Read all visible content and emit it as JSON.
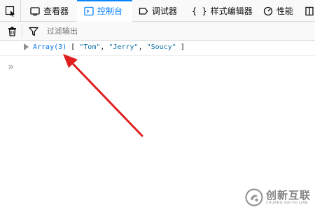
{
  "tabs": [
    {
      "label": "查看器",
      "icon": "inspector-icon"
    },
    {
      "label": "控制台",
      "icon": "console-icon",
      "selected": true
    },
    {
      "label": "调试器",
      "icon": "debugger-icon"
    },
    {
      "label": "样式编辑器",
      "icon": "style-editor-icon"
    },
    {
      "label": "性能",
      "icon": "performance-icon"
    },
    {
      "label": "",
      "icon": "more-tools-icon"
    }
  ],
  "toolbar": {
    "clear_icon": "trash-icon",
    "filter_icon": "filter-icon",
    "filter_placeholder": "过滤输出"
  },
  "console": {
    "message": {
      "array_name": "Array(3)",
      "open_bracket": "[",
      "items": [
        "\"Tom\"",
        "\"Jerry\"",
        "\"Soucy\""
      ],
      "separator": ", ",
      "close_bracket": "]"
    },
    "input_prompt": "»"
  },
  "annotation": {
    "arrow_color": "#e02020"
  },
  "watermark": {
    "name": "创新互联",
    "subtitle": "CHUANG XIN HU LIAN"
  },
  "colors": {
    "accent": "#0a84ff",
    "toolbar_bg": "#f9f9fa",
    "border": "#d7d7db"
  }
}
